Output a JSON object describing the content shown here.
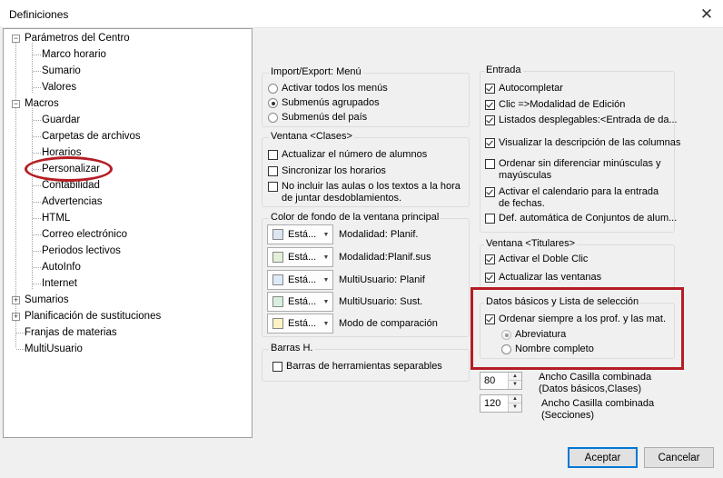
{
  "window": {
    "title": "Definiciones",
    "close_glyph": "✕"
  },
  "tree": {
    "items": [
      {
        "label": "Parámetros del Centro",
        "level": 0,
        "expander": "minus"
      },
      {
        "label": "Marco horario",
        "level": 1
      },
      {
        "label": "Sumario",
        "level": 1
      },
      {
        "label": "Valores",
        "level": 1
      },
      {
        "label": "Macros",
        "level": 0,
        "expander": "minus"
      },
      {
        "label": "Guardar",
        "level": 1
      },
      {
        "label": "Carpetas de archivos",
        "level": 1
      },
      {
        "label": "Horarios",
        "level": 1
      },
      {
        "label": "Personalizar",
        "level": 1,
        "selected": true
      },
      {
        "label": "Contabilidad",
        "level": 1
      },
      {
        "label": "Advertencias",
        "level": 1
      },
      {
        "label": "HTML",
        "level": 1
      },
      {
        "label": "Correo electrónico",
        "level": 1
      },
      {
        "label": "Periodos lectivos",
        "level": 1
      },
      {
        "label": "AutoInfo",
        "level": 1
      },
      {
        "label": "Internet",
        "level": 1
      },
      {
        "label": "Sumarios",
        "level": 0,
        "expander": "plus"
      },
      {
        "label": "Planificación de sustituciones",
        "level": 0,
        "expander": "plus"
      },
      {
        "label": "Franjas de materias",
        "level": 0
      },
      {
        "label": "MultiUsuario",
        "level": 0
      }
    ],
    "expander_minus": "−",
    "expander_plus": "+"
  },
  "import_export": {
    "title": "Import/Export: Menú",
    "options": [
      {
        "label": "Activar todos los menús",
        "checked": false
      },
      {
        "label": "Submenús agrupados",
        "checked": true
      },
      {
        "label": "Submenús del país",
        "checked": false
      }
    ]
  },
  "ventana_clases": {
    "title": "Ventana <Clases>",
    "options": [
      {
        "label": "Actualizar el número de alumnos",
        "checked": false
      },
      {
        "label": "Sincronizar los horarios",
        "checked": false
      },
      {
        "label": "No incluir las aulas o los textos a la hora de juntar desdoblamientos.",
        "checked": false
      }
    ]
  },
  "color_fondo": {
    "title": "Color de fondo de la ventana principal",
    "arrow": "▼",
    "rows": [
      {
        "value": "Está...",
        "swatch": "#dce6f2",
        "label": "Modalidad: Planif."
      },
      {
        "value": "Está...",
        "swatch": "#e3efd9",
        "label": "Modalidad:Planif.sus"
      },
      {
        "value": "Está...",
        "swatch": "#dde9f7",
        "label": "MultiUsuario: Planif"
      },
      {
        "value": "Está...",
        "swatch": "#d8eedf",
        "label": "MultiUsuario: Sust."
      },
      {
        "value": "Está...",
        "swatch": "#fff3c4",
        "label": "Modo de comparación"
      }
    ]
  },
  "barras": {
    "title": "Barras H.",
    "options": [
      {
        "label": "Barras de herramientas separables",
        "checked": false
      }
    ]
  },
  "entrada": {
    "title": "Entrada",
    "options": [
      {
        "label": "Autocompletar",
        "checked": true
      },
      {
        "label": "Clic =>Modalidad de Edición",
        "checked": true
      },
      {
        "label": "Listados desplegables:<Entrada de da...",
        "checked": true
      },
      {
        "label": "Visualizar la descripción de las columnas",
        "checked": true
      },
      {
        "label": "Ordenar sin diferenciar minúsculas y mayúsculas",
        "checked": false
      },
      {
        "label": "Activar el calendario para la entrada de fechas.",
        "checked": true
      },
      {
        "label": "Def. automática de Conjuntos de alum...",
        "checked": false
      }
    ]
  },
  "ventana_titulares": {
    "title": "Ventana <Titulares>",
    "options": [
      {
        "label": "Activar el Doble Clic",
        "checked": true
      },
      {
        "label": "Actualizar las ventanas",
        "checked": true
      }
    ]
  },
  "datos_basicos": {
    "title": "Datos básicos y Lista de selección",
    "ordenar": {
      "label": "Ordenar siempre a los prof. y las mat.",
      "checked": true
    },
    "radios": [
      {
        "label": "Abreviatura",
        "checked": true
      },
      {
        "label": "Nombre completo",
        "checked": false
      }
    ]
  },
  "spinners": {
    "up": "▲",
    "down": "▼",
    "items": [
      {
        "value": "80",
        "label_line1": "Ancho Casilla combinada",
        "label_line2": "(Datos básicos,Clases)"
      },
      {
        "value": "120",
        "label_line1": "Ancho Casilla combinada",
        "label_line2": "(Secciones)"
      }
    ]
  },
  "buttons": {
    "accept": "Aceptar",
    "cancel": "Cancelar"
  },
  "colors": {
    "highlight": "#b51d24",
    "default_button_border": "#0078d7"
  }
}
